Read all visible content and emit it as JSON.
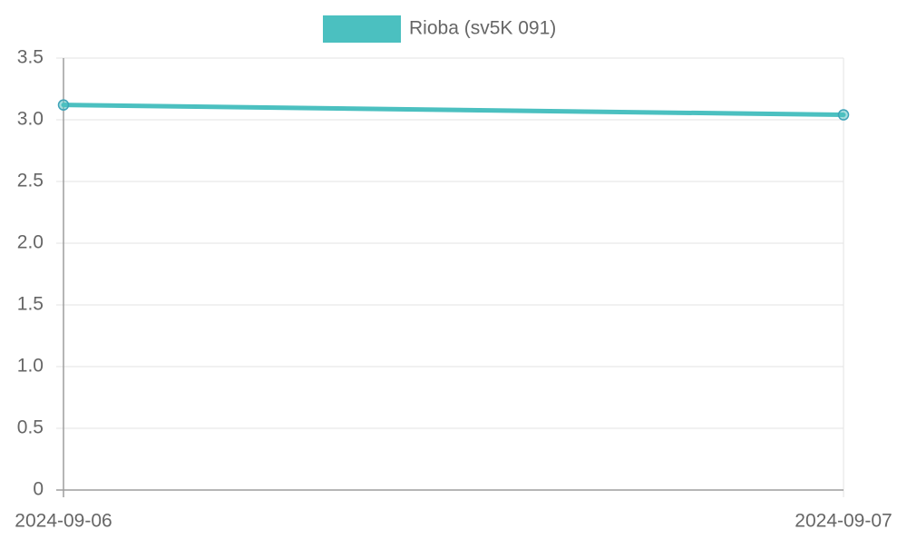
{
  "chart_data": {
    "type": "line",
    "x": [
      "2024-09-06",
      "2024-09-07"
    ],
    "series": [
      {
        "name": "Rioba (sv5K 091)",
        "values": [
          3.12,
          3.04
        ],
        "color": "#4bc0c0"
      }
    ],
    "ylim": [
      0,
      3.5
    ],
    "yticks": [
      "0",
      "0.5",
      "1.0",
      "1.5",
      "2.0",
      "2.5",
      "3.0",
      "3.5"
    ],
    "grid": true,
    "legend": "top-center"
  }
}
